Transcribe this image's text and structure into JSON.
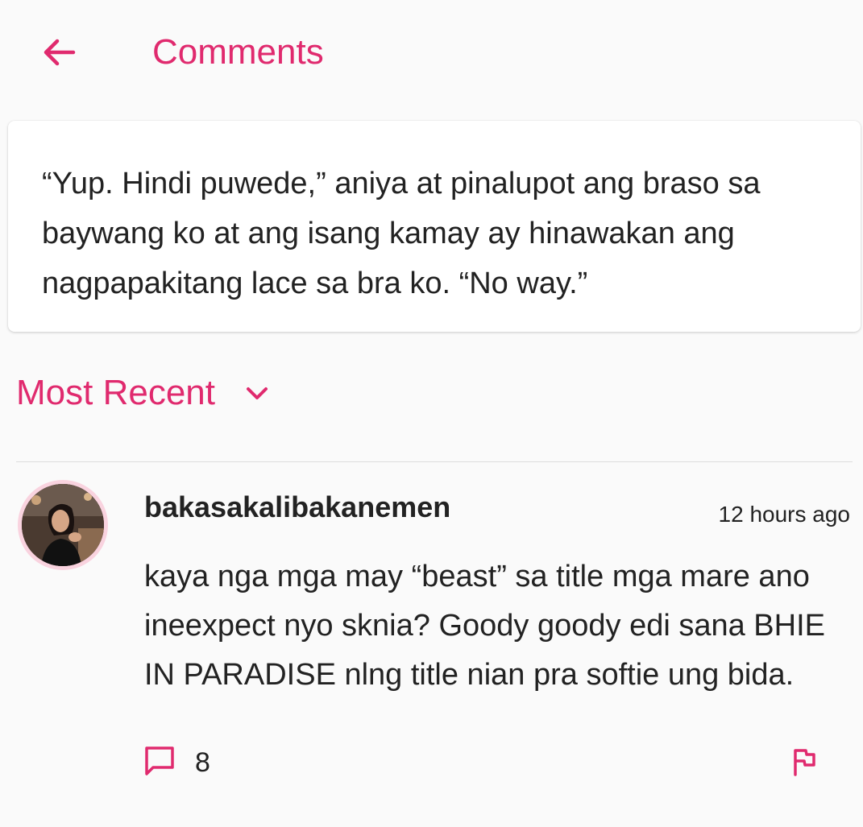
{
  "header": {
    "title": "Comments",
    "back_icon": "arrow-left-icon"
  },
  "colors": {
    "accent": "#e02a6e",
    "background": "#fafafa",
    "card": "#ffffff",
    "text": "#222222",
    "avatar_ring": "#f9d3df"
  },
  "quote": {
    "text": "“Yup. Hindi puwede,” aniya at pinalupot ang braso sa baywang ko at ang isang kamay ay hinawakan ang nagpapakitang lace sa bra ko. “No way.”"
  },
  "sort": {
    "label": "Most Recent",
    "icon": "chevron-down-icon"
  },
  "comments": [
    {
      "username": "bakasakalibakanemen",
      "timestamp": "12 hours ago",
      "text": "kaya nga mga may “beast” sa title mga mare ano ineexpect nyo sknia? Goody goody edi sana BHIE IN PARADISE nlng title nian pra softie ung bida.",
      "reply_count": "8",
      "reply_icon": "comment-icon",
      "flag_icon": "flag-icon"
    }
  ]
}
